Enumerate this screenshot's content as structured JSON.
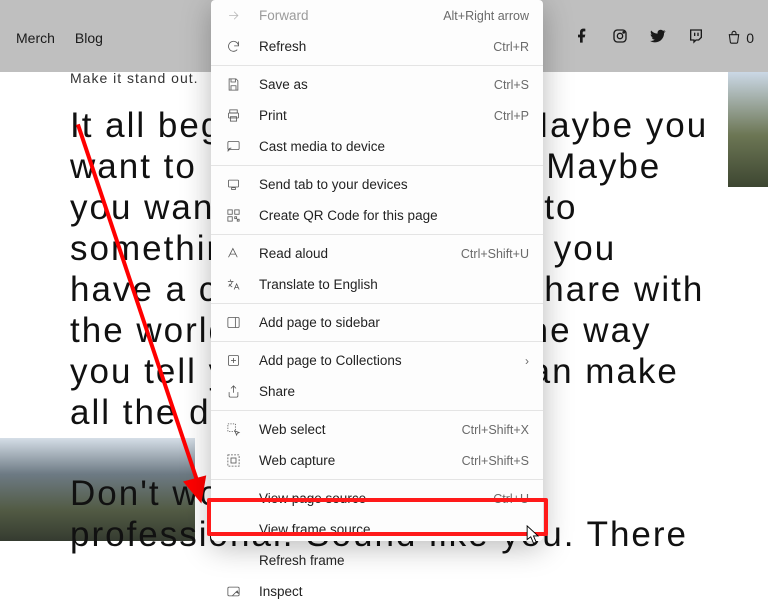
{
  "nav": {
    "merch": "Merch",
    "blog": "Blog",
    "cart_count": "0"
  },
  "page": {
    "standout": "Make it stand out.",
    "headline": "It all begins with an idea. Maybe you want to launch a business. Maybe you want to turn a hobby into something more. Or maybe you have a creative project to share with the world. Whatever it is, the way you tell your story online can make all the difference.",
    "headline2": "Don't worry about sounding professional. Sound like you. There"
  },
  "menu": [
    {
      "icon": "forward",
      "label": "Forward",
      "shortcut": "Alt+Right arrow",
      "disabled": true
    },
    {
      "icon": "refresh",
      "label": "Refresh",
      "shortcut": "Ctrl+R"
    },
    {
      "sep": true
    },
    {
      "icon": "save",
      "label": "Save as",
      "shortcut": "Ctrl+S"
    },
    {
      "icon": "print",
      "label": "Print",
      "shortcut": "Ctrl+P"
    },
    {
      "icon": "cast",
      "label": "Cast media to device"
    },
    {
      "sep": true
    },
    {
      "icon": "send",
      "label": "Send tab to your devices"
    },
    {
      "icon": "qr",
      "label": "Create QR Code for this page"
    },
    {
      "sep": true
    },
    {
      "icon": "read",
      "label": "Read aloud",
      "shortcut": "Ctrl+Shift+U"
    },
    {
      "icon": "translate",
      "label": "Translate to English"
    },
    {
      "sep": true
    },
    {
      "icon": "sidebar",
      "label": "Add page to sidebar"
    },
    {
      "sep": true
    },
    {
      "icon": "collect",
      "label": "Add page to Collections",
      "submenu": true
    },
    {
      "icon": "share",
      "label": "Share"
    },
    {
      "sep": true
    },
    {
      "icon": "webselect",
      "label": "Web select",
      "shortcut": "Ctrl+Shift+X"
    },
    {
      "icon": "webcapture",
      "label": "Web capture",
      "shortcut": "Ctrl+Shift+S"
    },
    {
      "sep": true
    },
    {
      "icon": "",
      "label": "View page source",
      "shortcut": "Ctrl+U"
    },
    {
      "icon": "",
      "label": "View frame source"
    },
    {
      "icon": "",
      "label": "Refresh frame"
    },
    {
      "icon": "inspect",
      "label": "Inspect"
    }
  ]
}
